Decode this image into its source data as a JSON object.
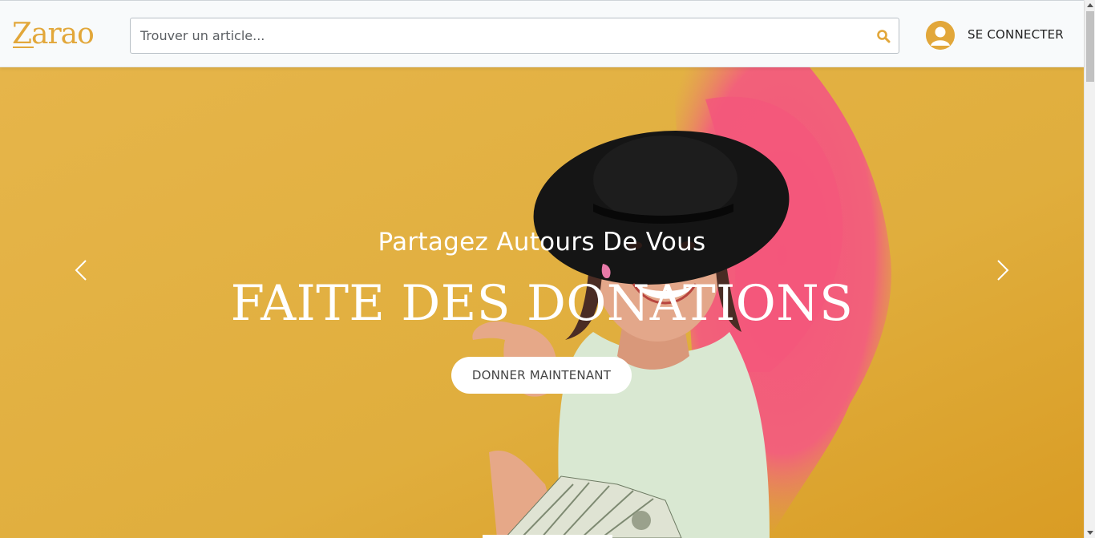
{
  "header": {
    "logo": "Zarao",
    "search_placeholder": "Trouver un article...",
    "login_label": "SE CONNECTER"
  },
  "hero": {
    "subtitle": "Partagez Autours De Vous",
    "title": "FAITE DES DONATIONS",
    "cta_label": "DONNER MAINTENANT"
  },
  "icons": {
    "search": "search-icon",
    "user": "user-avatar-icon",
    "prev": "chevron-left-icon",
    "next": "chevron-right-icon"
  },
  "colors": {
    "accent": "#e2a73a",
    "hero_yellow": "#e0b143",
    "hero_pink": "#f2577a"
  }
}
